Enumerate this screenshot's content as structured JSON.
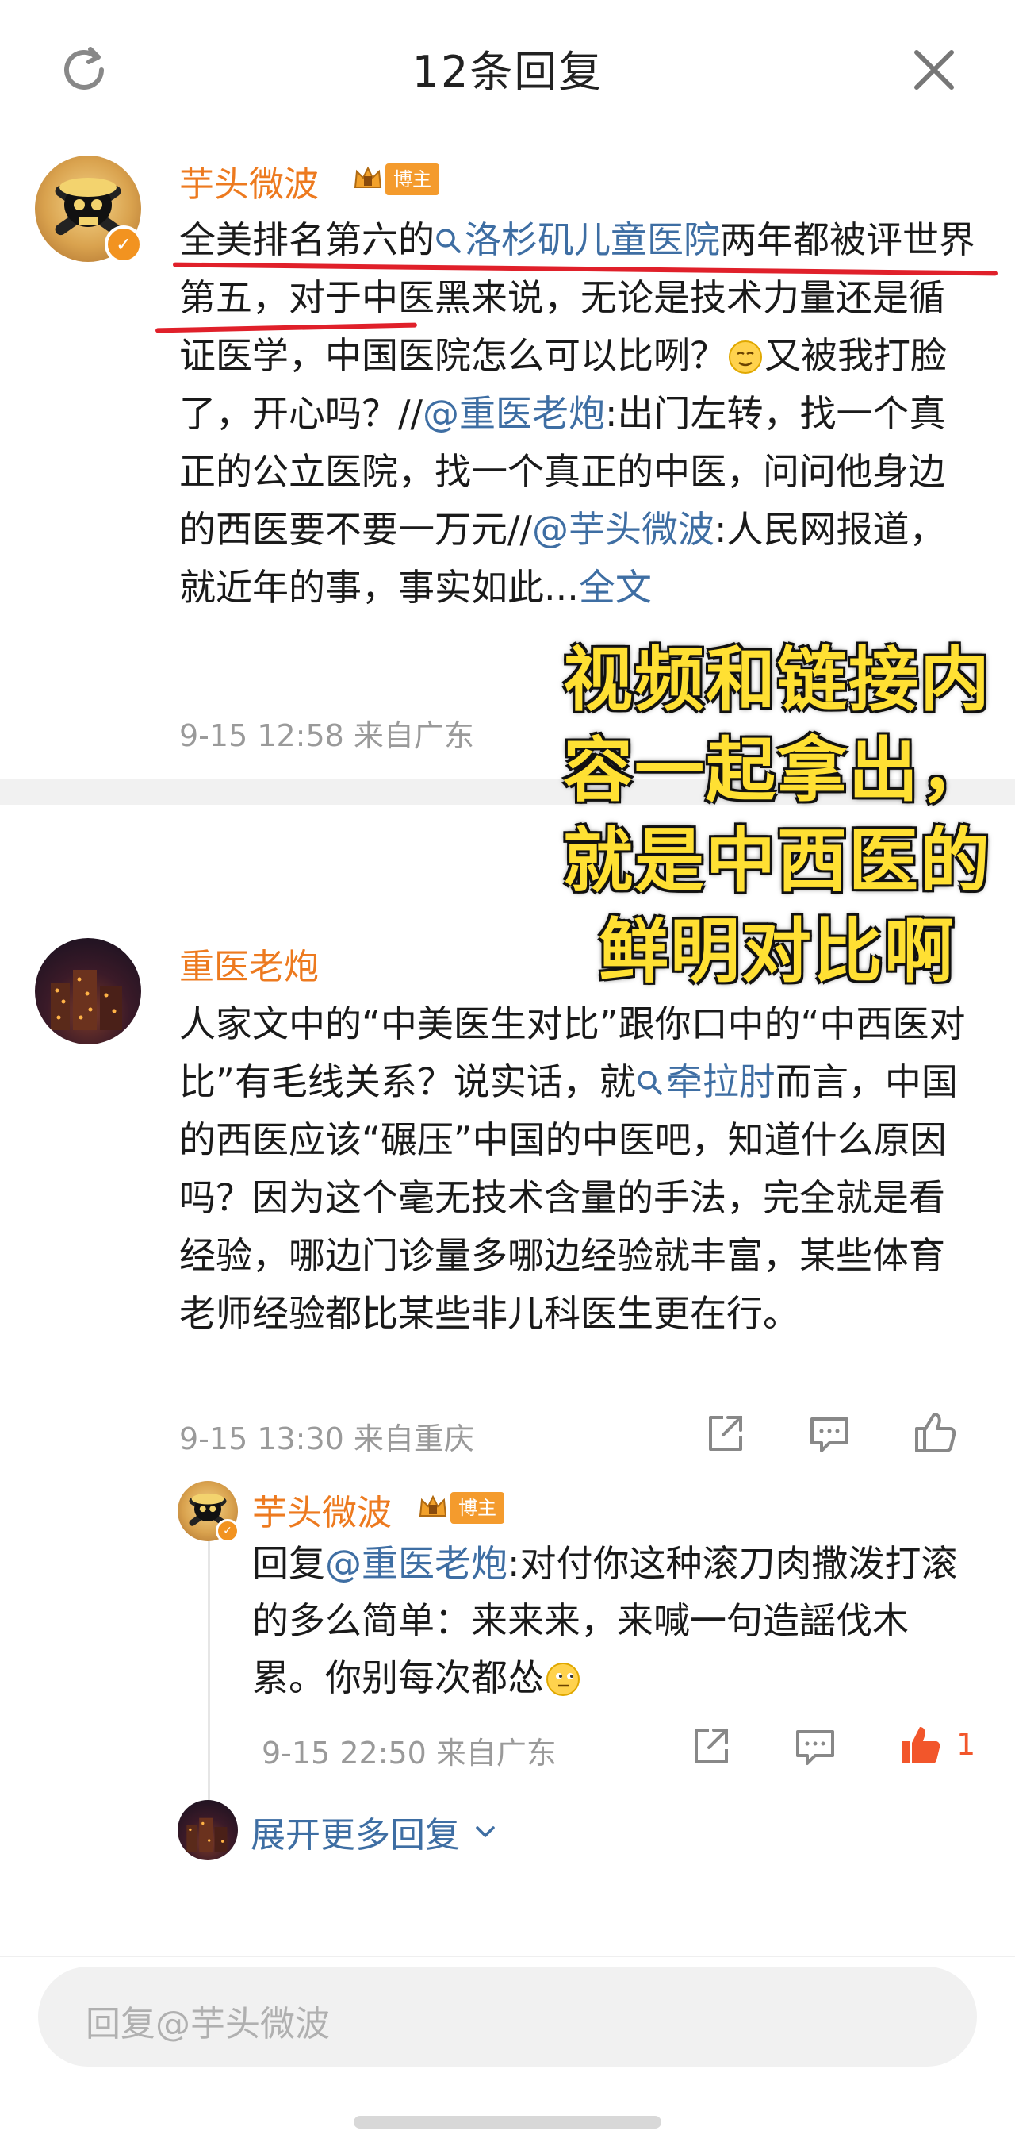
{
  "header": {
    "title": "12条回复",
    "refresh_icon": "refresh-icon",
    "close_icon": "close-icon"
  },
  "post1": {
    "author": "芋头微波",
    "badge": "博主",
    "text_1": "全美排名第六的",
    "link_topic": "洛杉矶儿童医院",
    "text_2": "两年都被评世界第五，对于中医黑来说，无论是技术力量还是循证医学，中国医院怎么可以比咧？",
    "text_3": "又被我打脸了，开心吗？//",
    "mention_1": "@重医老炮",
    "text_4": ":出门左转，找一个真正的公立医院，找一个真正的中医，问问他身边的西医要不要一万元//",
    "mention_2": "@芋头微波",
    "text_5": ":人民网报道，就近年的事，事实如此...",
    "full_text_link": "全文",
    "meta": "9-15 12:58 来自广东"
  },
  "overlay_caption": [
    "视频和链接内",
    "容一起拿出，",
    "就是中西医的",
    "鲜明对比啊"
  ],
  "post2": {
    "author": "重医老炮",
    "text_1": "人家文中的“中美医生对比”跟你口中的“中西医对比”有毛线关系？说实话，就",
    "link_topic": "牵拉肘",
    "text_2": "而言，中国的西医应该“碾压”中国的中医吧，知道什么原因吗？因为这个毫无技术含量的手法，完全就是看经验，哪边门诊量多哪边经验就丰富，某些体育老师经验都比某些非儿科医生更在行。",
    "meta": "9-15 13:30 来自重庆"
  },
  "reply1": {
    "author": "芋头微波",
    "badge": "博主",
    "text_1": "回复",
    "mention": "@重医老炮",
    "text_2": ":对付你这种滚刀肉撒泼打滚的多么简单：来来来，来喊一句造謡伐木累。你别每次都怂",
    "meta": "9-15 22:50 来自广东",
    "like_count": "1"
  },
  "expand_more": "展开更多回复",
  "reply_input": {
    "placeholder": "回复@芋头微波"
  },
  "colors": {
    "username": "#ed7a1f",
    "link": "#3e6ea3",
    "like_active": "#f2562b",
    "overlay_text": "#ffe033",
    "underline": "#e0202a"
  }
}
